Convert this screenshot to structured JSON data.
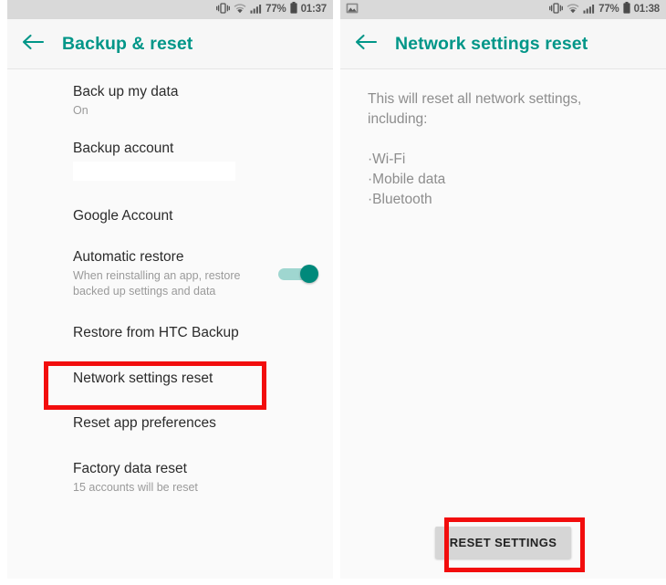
{
  "left_panel": {
    "statusbar": {
      "vibrate_icon": "vibrate-icon",
      "wifi_icon": "wifi-icon",
      "signal_icon": "signal-icon",
      "battery_percent": "77%",
      "battery_icon": "battery-icon",
      "clock": "01:37"
    },
    "appbar": {
      "back_icon": "back-arrow-icon",
      "title": "Backup & reset"
    },
    "items": [
      {
        "title": "Back up my data",
        "subtitle": "On"
      },
      {
        "title": "Backup account",
        "subtitle": ""
      },
      {
        "title": "Google Account",
        "subtitle": ""
      },
      {
        "title": "Automatic restore",
        "subtitle": "When reinstalling an app, restore backed up settings and data"
      },
      {
        "title": "Restore from HTC Backup",
        "subtitle": ""
      },
      {
        "title": "Network settings reset",
        "subtitle": ""
      },
      {
        "title": "Reset app preferences",
        "subtitle": ""
      },
      {
        "title": "Factory data reset",
        "subtitle": "15 accounts will be reset"
      }
    ],
    "toggle_state": "on"
  },
  "right_panel": {
    "statusbar": {
      "screenshot_icon": "image-notification-icon",
      "vibrate_icon": "vibrate-icon",
      "wifi_icon": "wifi-icon",
      "signal_icon": "signal-icon",
      "battery_percent": "77%",
      "battery_icon": "battery-icon",
      "clock": "01:38"
    },
    "appbar": {
      "back_icon": "back-arrow-icon",
      "title": "Network settings reset"
    },
    "description": "This will reset all network settings, including:",
    "bullets": [
      "·Wi-Fi",
      "·Mobile data",
      "·Bluetooth"
    ],
    "reset_button_label": "RESET SETTINGS"
  },
  "annotations": {
    "highlight_color": "#f20d0d",
    "boxes": [
      {
        "target": "Network settings reset"
      },
      {
        "target": "RESET SETTINGS"
      }
    ]
  },
  "colors": {
    "accent_teal": "#009688",
    "toggle_on": "#00897b",
    "status_bar_bg": "#d9d9d9",
    "panel_bg": "#fafafa"
  }
}
